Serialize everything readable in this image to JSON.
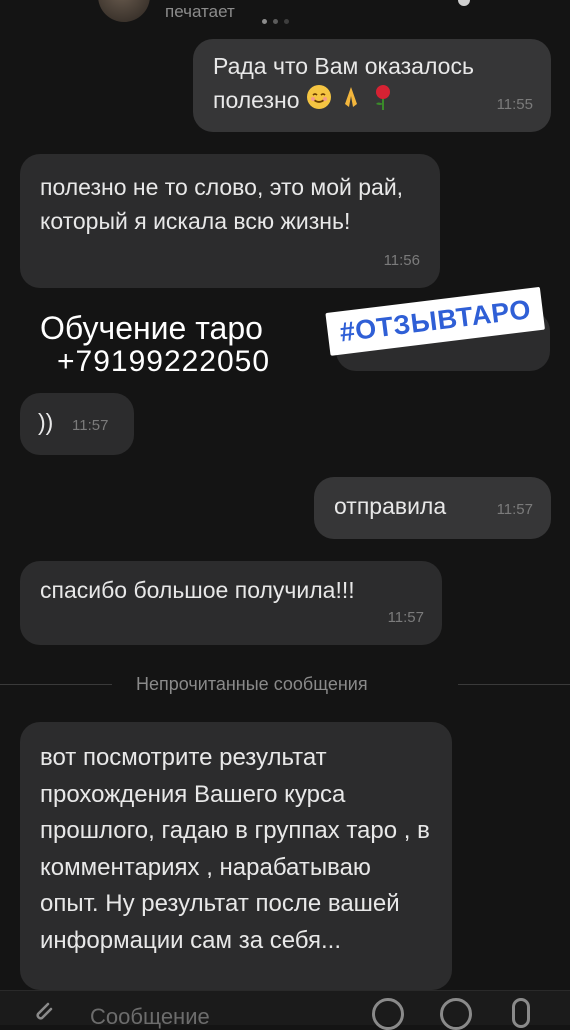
{
  "header": {
    "status": "печатает"
  },
  "messages": [
    {
      "text": "Рада что Вам оказалось полезно",
      "time": "11:55",
      "outgoing": true,
      "emojis": [
        "smile-emoji",
        "pray-emoji",
        "rose-emoji"
      ]
    },
    {
      "text": "полезно не то слово, это мой рай, который я искала всю жизнь!",
      "time": "11:56",
      "outgoing": false
    },
    {
      "text": "))",
      "time": "11:57",
      "outgoing": false
    },
    {
      "text": "отправила",
      "time": "11:57",
      "outgoing": true
    },
    {
      "text": "спасибо большое получила!!!",
      "time": "11:57",
      "outgoing": false
    },
    {
      "text": "вот посмотрите результат прохождения Вашего курса прошлого, гадаю в группах таро , в комментариях , нарабатываю опыт. Ну результат после вашей информации сам за себя...",
      "outgoing": false
    }
  ],
  "overlay": {
    "ad_title": "Обучение таро",
    "ad_phone": "+79199222050",
    "hashtag": "#ОТЗЫВТАРО"
  },
  "divider": {
    "label": "Непрочитанные сообщения"
  },
  "composer": {
    "placeholder": "Сообщение"
  },
  "colors": {
    "background": "#141414",
    "bubble_in": "#2c2c2d",
    "bubble_out": "#363637",
    "hashtag": "#2f5fd6"
  }
}
